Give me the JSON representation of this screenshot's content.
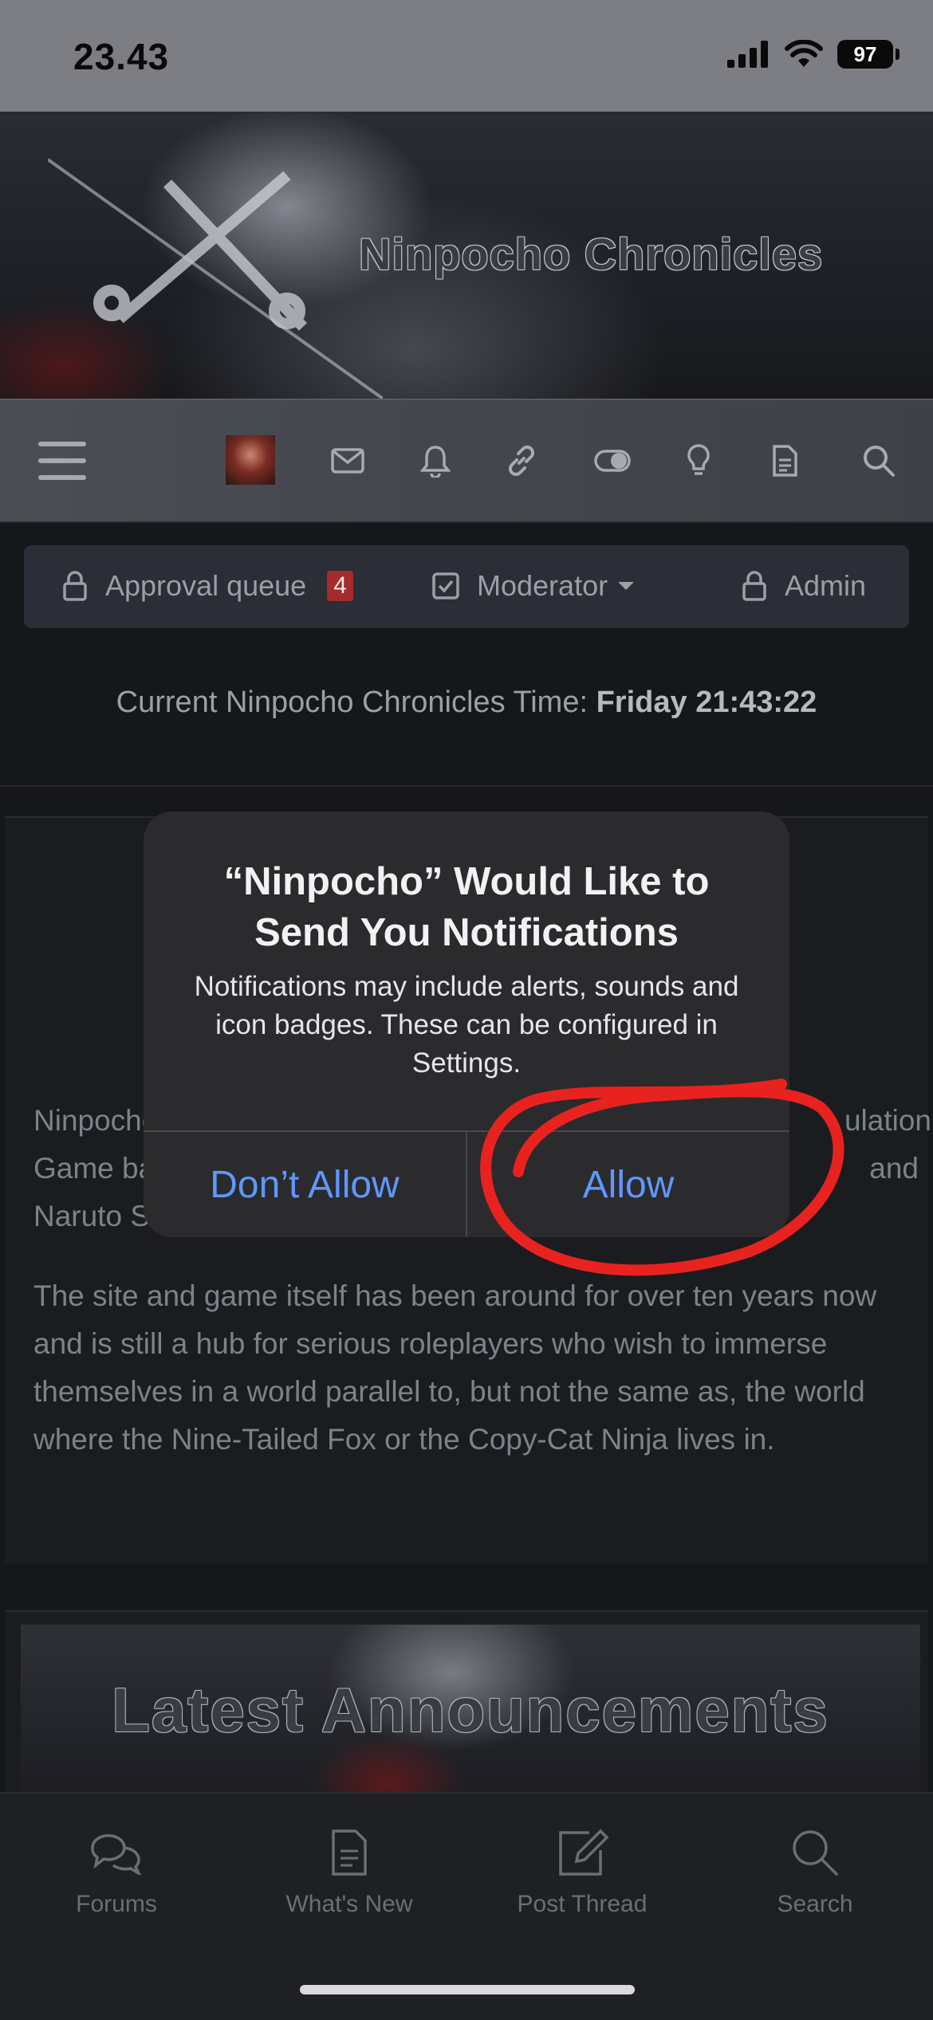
{
  "status_bar": {
    "time": "23.43",
    "battery": "97"
  },
  "banner": {
    "title": "Ninpocho Chronicles"
  },
  "nav": {
    "icons": [
      "menu-icon",
      "avatar",
      "mail-icon",
      "bell-icon",
      "link-icon",
      "toggle-icon",
      "lightbulb-icon",
      "document-icon",
      "search-icon"
    ]
  },
  "mod_bar": {
    "approval_queue_label": "Approval queue",
    "approval_queue_count": "4",
    "moderator_label": "Moderator",
    "admin_label": "Admin"
  },
  "time_line": {
    "label": "Current Ninpocho Chronicles Time:",
    "value": "Friday 21:43:22"
  },
  "content": {
    "para1_lines": [
      "Ninpocho",
      "ulation",
      "Game ba",
      "and",
      "Naruto S"
    ],
    "para2": "The site and game itself has been around for over ten years now and is still a hub for serious roleplayers who wish to immerse themselves in a world parallel to, but not the same as, the world where the Nine-Tailed Fox or the Copy-Cat Ninja lives in."
  },
  "announcements": {
    "title": "Latest Announcements"
  },
  "tabbar": {
    "tabs": [
      {
        "label": "Forums",
        "icon": "chat-bubbles-icon"
      },
      {
        "label": "What's New",
        "icon": "document-icon"
      },
      {
        "label": "Post Thread",
        "icon": "compose-icon"
      },
      {
        "label": "Search",
        "icon": "search-icon"
      }
    ]
  },
  "alert": {
    "title": "“Ninpocho” Would Like to Send You Notifications",
    "message": "Notifications may include alerts, sounds and icon badges. These can be configured in Settings.",
    "deny_label": "Don’t Allow",
    "allow_label": "Allow"
  },
  "colors": {
    "accent": "#5f97ff",
    "annotation": "#e8231f",
    "badge": "#a62b2b"
  }
}
